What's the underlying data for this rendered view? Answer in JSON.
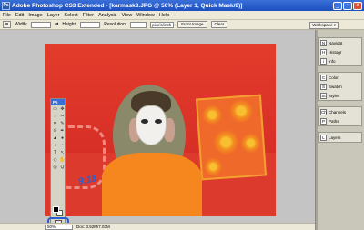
{
  "app": {
    "title": "Adobe Photoshop CS3 Extended - [karmask3.JPG @ 50% (Layer 1, Quick Mask/8)]",
    "icon_label": "Ps"
  },
  "window_buttons": [
    "_",
    "▫",
    "x"
  ],
  "menu": [
    "File",
    "Edit",
    "Image",
    "Layer",
    "Select",
    "Filter",
    "Analysis",
    "View",
    "Window",
    "Help"
  ],
  "options": {
    "width_label": "Width:",
    "height_label": "Height:",
    "resolution_label": "Resolution:",
    "resolution_unit": "pixels/inch",
    "front_image_button": "Front Image",
    "clear_button": "Clear",
    "workspace_button": "Workspace ▾"
  },
  "status": {
    "zoom": "50%",
    "doc_info": "Doc: 3.52M/7.03M"
  },
  "toolbox": {
    "header": "Ps",
    "tools": [
      "▭",
      "✥",
      "◌",
      "✂",
      "⌗",
      "✎",
      "⊙",
      "✒",
      "▲",
      "●",
      "◑",
      "◔",
      "T",
      "↖",
      "◇",
      "✋",
      "◎",
      "Q"
    ]
  },
  "annotation": "9:18",
  "panels": [
    {
      "label": "Navigat",
      "icon": "N"
    },
    {
      "label": "Histogr",
      "icon": "H"
    },
    {
      "label": "Info",
      "icon": "i"
    },
    {
      "label": "Color",
      "icon": "C"
    },
    {
      "label": "Swatch",
      "icon": "S"
    },
    {
      "label": "Styles",
      "icon": "St"
    },
    {
      "label": "Channels",
      "icon": "Ch"
    },
    {
      "label": "Paths",
      "icon": "P"
    },
    {
      "label": "Layers",
      "icon": "L"
    }
  ],
  "colors": {
    "title_bar": "#1c4fbf",
    "quick_mask_overlay": "#e3342a",
    "highlight_ring": "#2a5fd0"
  }
}
